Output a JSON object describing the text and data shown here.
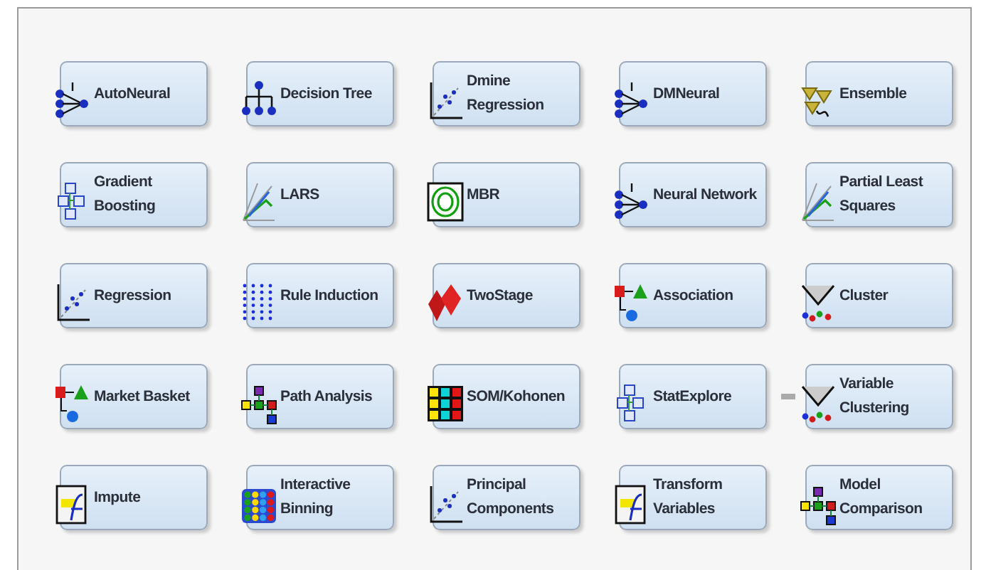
{
  "nodes": [
    {
      "label": "AutoNeural"
    },
    {
      "label": "Decision Tree"
    },
    {
      "label": "Dmine Regression"
    },
    {
      "label": "DMNeural"
    },
    {
      "label": "Ensemble"
    },
    {
      "label": "Gradient Boosting"
    },
    {
      "label": "LARS"
    },
    {
      "label": "MBR"
    },
    {
      "label": "Neural Network"
    },
    {
      "label": "Partial Least Squares"
    },
    {
      "label": "Regression"
    },
    {
      "label": "Rule Induction"
    },
    {
      "label": "TwoStage"
    },
    {
      "label": "Association"
    },
    {
      "label": "Cluster"
    },
    {
      "label": "Market Basket"
    },
    {
      "label": "Path Analysis"
    },
    {
      "label": "SOM/Kohonen"
    },
    {
      "label": "StatExplore"
    },
    {
      "label": "Variable Clustering"
    },
    {
      "label": "Impute"
    },
    {
      "label": "Interactive Binning"
    },
    {
      "label": "Principal Components"
    },
    {
      "label": "Transform Variables"
    },
    {
      "label": "Model Comparison"
    }
  ]
}
